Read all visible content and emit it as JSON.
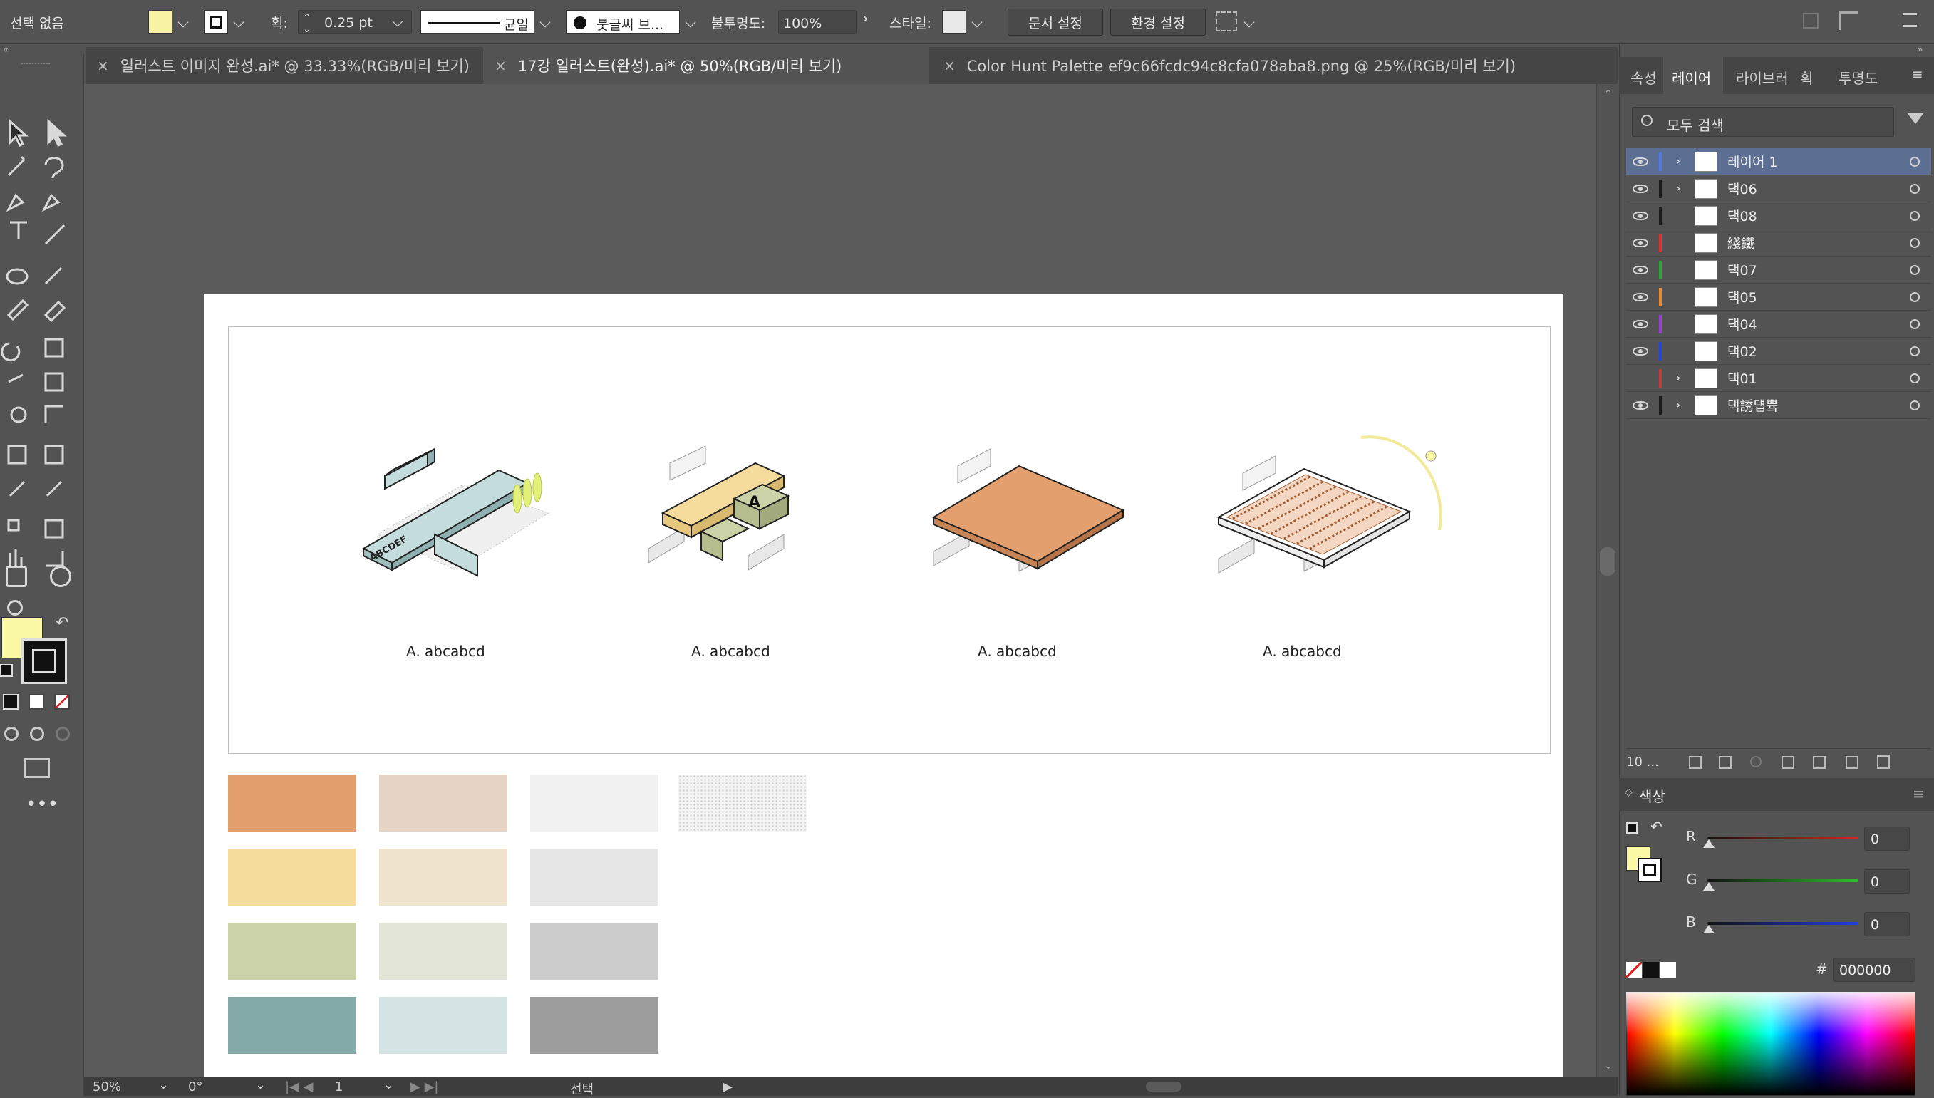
{
  "control_bar": {
    "selection_label": "선택 없음",
    "stroke_label": "획:",
    "stroke_value": "0.25 pt",
    "line_profile": "균일",
    "brush_label": "붓글씨 브...",
    "opacity_label": "불투명도:",
    "opacity_value": "100%",
    "style_label": "스타일:",
    "doc_setup_button": "문서 설정",
    "preferences_button": "환경 설정"
  },
  "tabs": [
    {
      "label": "일러스트 이미지 완성.ai* @ 33.33%(RGB/미리 보기)",
      "active": false
    },
    {
      "label": "17강 일러스트(완성).ai* @ 50%(RGB/미리 보기)",
      "active": true
    },
    {
      "label": "Color Hunt Palette ef9c66fcdc94c8cfa078aba8.png @ 25%(RGB/미리 보기)",
      "active": false
    }
  ],
  "artboard": {
    "captions": [
      "A.  abcabcd",
      "A.  abcabcd",
      "A.  abcabcd",
      "A.  abcabcd"
    ],
    "sign_text": "ABCDEF",
    "box_letter": "A"
  },
  "palette": {
    "rows": [
      [
        "#e3a06e",
        "#e5d3c6",
        "#f1f1f1",
        "texture"
      ],
      [
        "#f6dc9c",
        "#f1e4cf",
        "#e6e6e6"
      ],
      [
        "#cbd2a8",
        "#e4e5d9",
        "#cccccc"
      ],
      [
        "#83aaa8",
        "#d4e4e4",
        "#9d9d9d"
      ]
    ]
  },
  "panel": {
    "tabs": [
      "속성",
      "레이어",
      "라이브러",
      "획",
      "투명도"
    ],
    "active_tab": "레이어",
    "search_placeholder": "모두 검색",
    "layers": [
      {
        "name": "레이어 1",
        "color": "#4e79e6",
        "expandable": true,
        "selected": true,
        "visible": true
      },
      {
        "name": "댁06",
        "color": "#1c1c1c",
        "expandable": true,
        "selected": false,
        "visible": true
      },
      {
        "name": "댁08",
        "color": "#1c1c1c",
        "expandable": false,
        "selected": false,
        "visible": true
      },
      {
        "name": "綫鐵",
        "color": "#e0312f",
        "expandable": false,
        "selected": false,
        "visible": true
      },
      {
        "name": "댁07",
        "color": "#2da63a",
        "expandable": false,
        "selected": false,
        "visible": true
      },
      {
        "name": "댁05",
        "color": "#ef8a2a",
        "expandable": false,
        "selected": false,
        "visible": true
      },
      {
        "name": "댁04",
        "color": "#9c3fd6",
        "expandable": false,
        "selected": false,
        "visible": true
      },
      {
        "name": "댁02",
        "color": "#2444e0",
        "expandable": false,
        "selected": false,
        "visible": true
      },
      {
        "name": "댁01",
        "color": "#c23a3a",
        "expandable": true,
        "selected": false,
        "visible": false
      },
      {
        "name": "댁誘덉쁔",
        "color": "#1c1c1c",
        "expandable": true,
        "selected": false,
        "visible": true
      }
    ],
    "layer_count": "10 ...",
    "color_panel_title": "색상",
    "r_label": "R",
    "r_value": "0",
    "g_label": "G",
    "g_value": "0",
    "b_label": "B",
    "b_value": "0",
    "hash_label": "#",
    "hex_value": "000000"
  },
  "status": {
    "zoom": "50%",
    "rotate": "0°",
    "artboard_num": "1",
    "mode": "선택"
  },
  "colors": {
    "fill_swatch": "#fbf8a6",
    "stroke_swatch": "#111111"
  }
}
